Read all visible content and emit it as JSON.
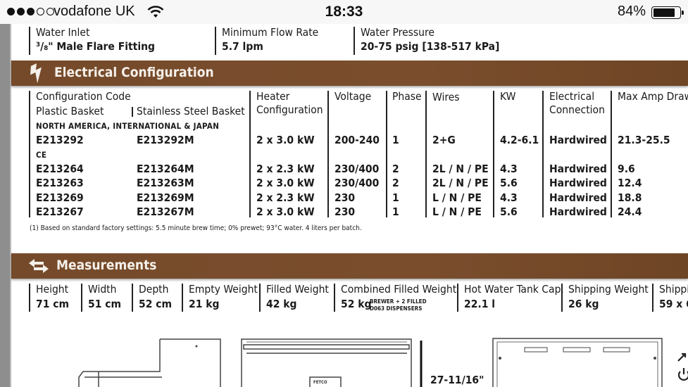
{
  "status_bar": {
    "carrier": "vodafone UK",
    "time": "18:33",
    "battery_percent": "84%",
    "battery_level": 0.84,
    "signal_dots_filled": 3,
    "signal_dots_total": 5
  },
  "water": {
    "inlet_label": "Water Inlet",
    "inlet_value": "³/₈\" Male Flare Fitting",
    "flow_label": "Minimum Flow Rate",
    "flow_value": "5.7 lpm",
    "pressure_label": "Water Pressure",
    "pressure_value": "20-75 psig [138-517 kPa]"
  },
  "electrical": {
    "title": "Electrical Configuration",
    "icon": "lightning-bolt-icon",
    "headers": {
      "config_code": "Configuration Code",
      "plastic": "Plastic Basket",
      "stainless": "Stainless Steel Basket",
      "heater_1": "Heater",
      "heater_2": "Configuration",
      "voltage": "Voltage",
      "phase": "Phase",
      "wires": "Wires",
      "kw": "KW",
      "connection_1": "Electrical",
      "connection_2": "Connection",
      "max_amp": "Max Amp Draw"
    },
    "region_na": "NORTH AMERICA, INTERNATIONAL & JAPAN",
    "region_ce": "CE",
    "rows": [
      {
        "plastic": "E213292",
        "stainless": "E213292M",
        "heater": "2 x 3.0 kW",
        "voltage": "200-240",
        "phase": "1",
        "wires": "2+G",
        "kw": "4.2-6.1",
        "connection": "Hardwired",
        "amp": "21.3-25.5"
      },
      {
        "plastic": "E213264",
        "stainless": "E213264M",
        "heater": "2 x 2.3 kW",
        "voltage": "230/400",
        "phase": "2",
        "wires": "2L / N / PE",
        "kw": "4.3",
        "connection": "Hardwired",
        "amp": "9.6"
      },
      {
        "plastic": "E213263",
        "stainless": "E213263M",
        "heater": "2 x 3.0 kW",
        "voltage": "230/400",
        "phase": "2",
        "wires": "2L / N / PE",
        "kw": "5.6",
        "connection": "Hardwired",
        "amp": "12.4"
      },
      {
        "plastic": "E213269",
        "stainless": "E213269M",
        "heater": "2 x 2.3 kW",
        "voltage": "230",
        "phase": "1",
        "wires": "L / N / PE",
        "kw": "4.3",
        "connection": "Hardwired",
        "amp": "18.8"
      },
      {
        "plastic": "E213267",
        "stainless": "E213267M",
        "heater": "2 x 3.0 kW",
        "voltage": "230",
        "phase": "1",
        "wires": "L / N / PE",
        "kw": "5.6",
        "connection": "Hardwired",
        "amp": "24.4"
      }
    ],
    "footnote": "(1) Based on standard factory settings: 5.5 minute brew time; 0% prewet; 93°C water. 4 liters per batch."
  },
  "measurements": {
    "title": "Measurements",
    "icon": "double-arrow-icon",
    "height_label": "Height",
    "height_value": "71 cm",
    "width_label": "Width",
    "width_value": "51 cm",
    "depth_label": "Depth",
    "depth_value": "52 cm",
    "empty_label": "Empty Weight",
    "empty_value": "21 kg",
    "filled_label": "Filled Weight",
    "filled_value": "42 kg",
    "combined_label": "Combined Filled Weight",
    "combined_value": "52 kg",
    "combined_note_1": "BREWER + 2 FILLED",
    "combined_note_2": "D063 DISPENSERS",
    "tank_label": "Hot Water Tank Cap.",
    "tank_value": "22.1 l",
    "shipping_label": "Shipping Weight",
    "shipping_value": "26 kg",
    "shipping2_label": "Shippi",
    "shipping2_value": "59 x 6"
  },
  "drawing": {
    "dimension_label": "27-11/16\"",
    "badge_text": "FETCO"
  }
}
